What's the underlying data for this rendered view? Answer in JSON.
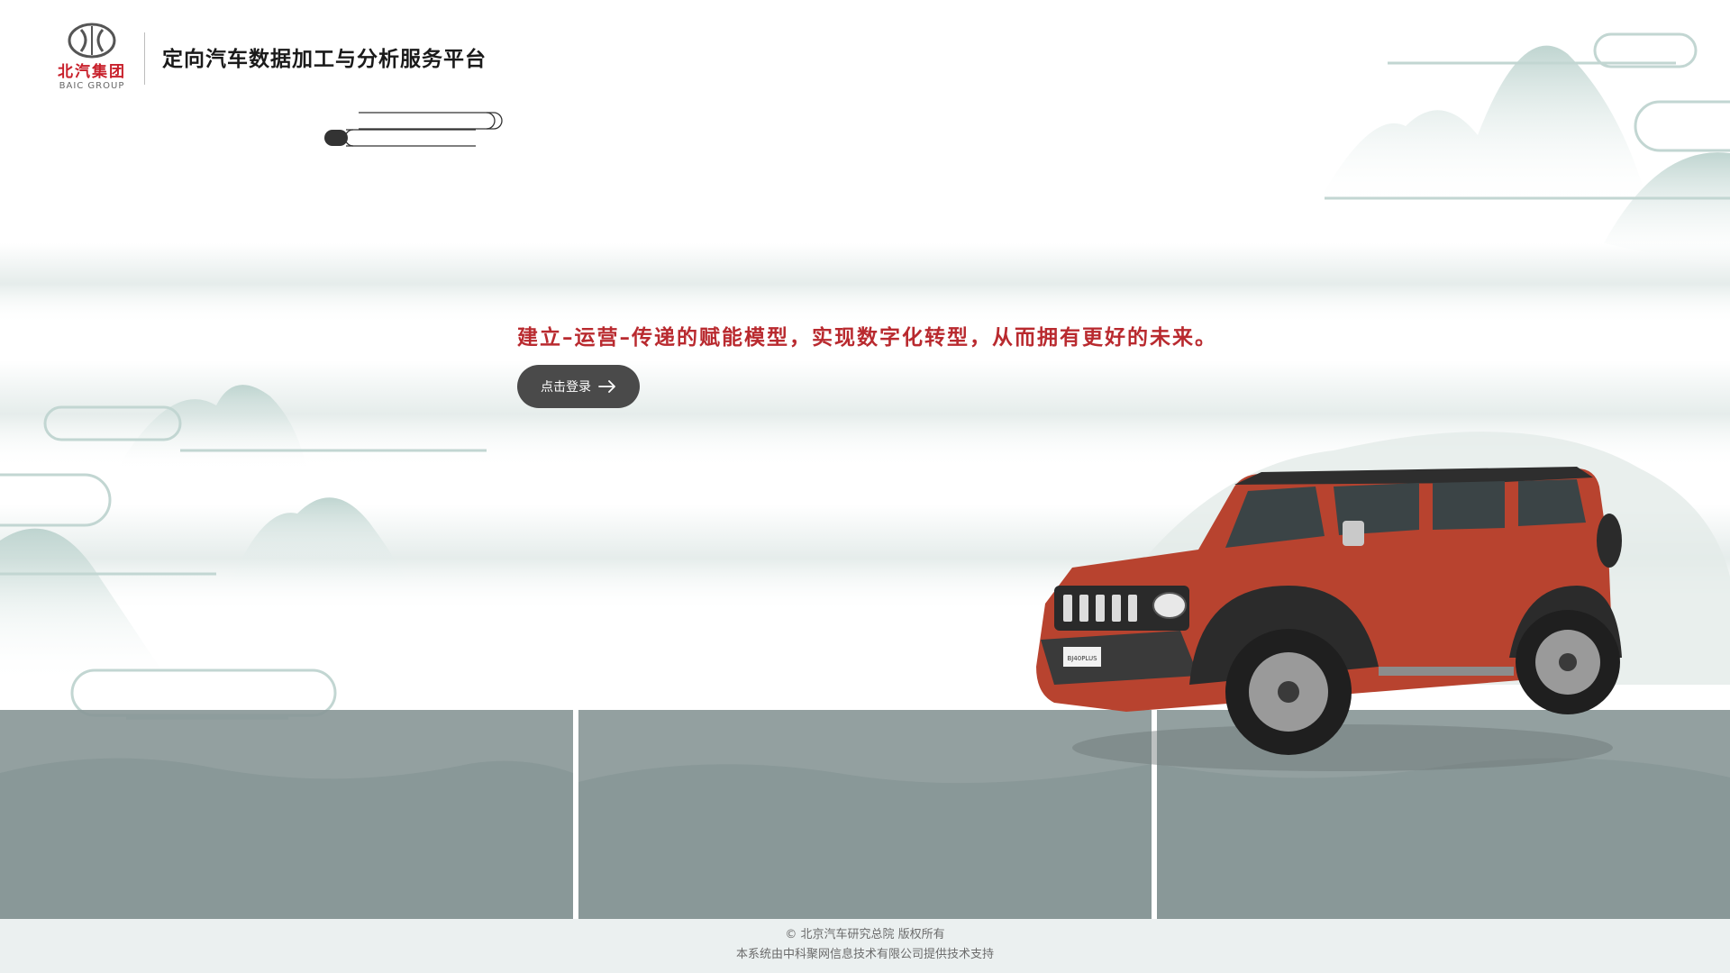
{
  "header": {
    "logo": {
      "name_cn": "北汽集团",
      "name_en": "BAIC GROUP"
    },
    "title": "定向汽车数据加工与分析服务平台"
  },
  "hero": {
    "slogan": "建立–运营–传递的赋能模型，实现数字化转型，从而拥有更好的未来。",
    "login_label": "点击登录",
    "login_icon": "arrow-right-icon"
  },
  "vehicle": {
    "plate_text": "BJ40PLUS"
  },
  "footer": {
    "copyright": "© 北京汽车研究总院 版权所有",
    "support": "本系统由中科聚网信息技术有限公司提供技术支持"
  },
  "colors": {
    "brand_red": "#c8202b",
    "slogan_red": "#b92a2f",
    "button_bg": "#4a4a4a",
    "panel_grey": "#8a9898",
    "footer_bg": "#ebf0f0",
    "mountain_teal": "#c9dcd8",
    "vehicle_red": "#b8432f"
  }
}
